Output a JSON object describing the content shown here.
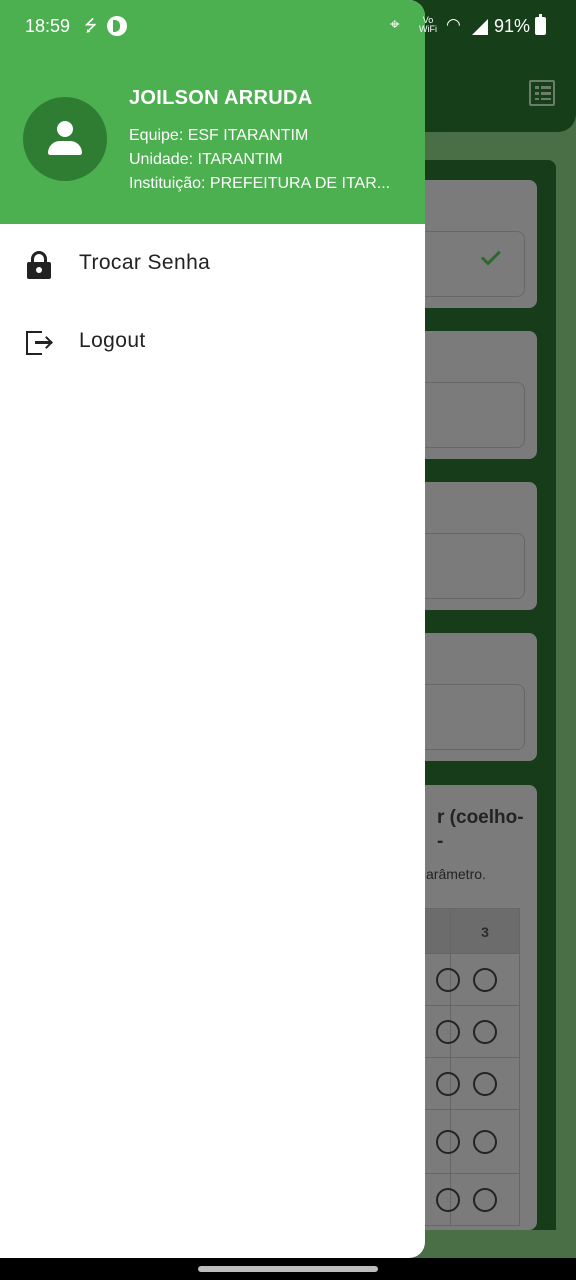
{
  "status_bar": {
    "time": "18:59",
    "usb_icon": "usb-icon",
    "vowifi": [
      "Vo",
      "WiFi"
    ],
    "battery": "91%"
  },
  "drawer": {
    "user": {
      "name": "JOILSON ARRUDA",
      "equipe": "Equipe: ESF ITARANTIM",
      "unidade": "Unidade: ITARANTIM",
      "instituicao": "Instituição: PREFEITURA DE ITAR..."
    },
    "menu": [
      {
        "label": "Trocar Senha",
        "icon": "lock-icon"
      },
      {
        "label": "Logout",
        "icon": "logout-icon"
      }
    ],
    "colors": {
      "header": "#4caf50",
      "avatar": "#2e7d32"
    }
  },
  "background": {
    "question_title": [
      "r (coelho-",
      "-"
    ],
    "question_hint": "arâmetro.",
    "table_header": "3"
  }
}
